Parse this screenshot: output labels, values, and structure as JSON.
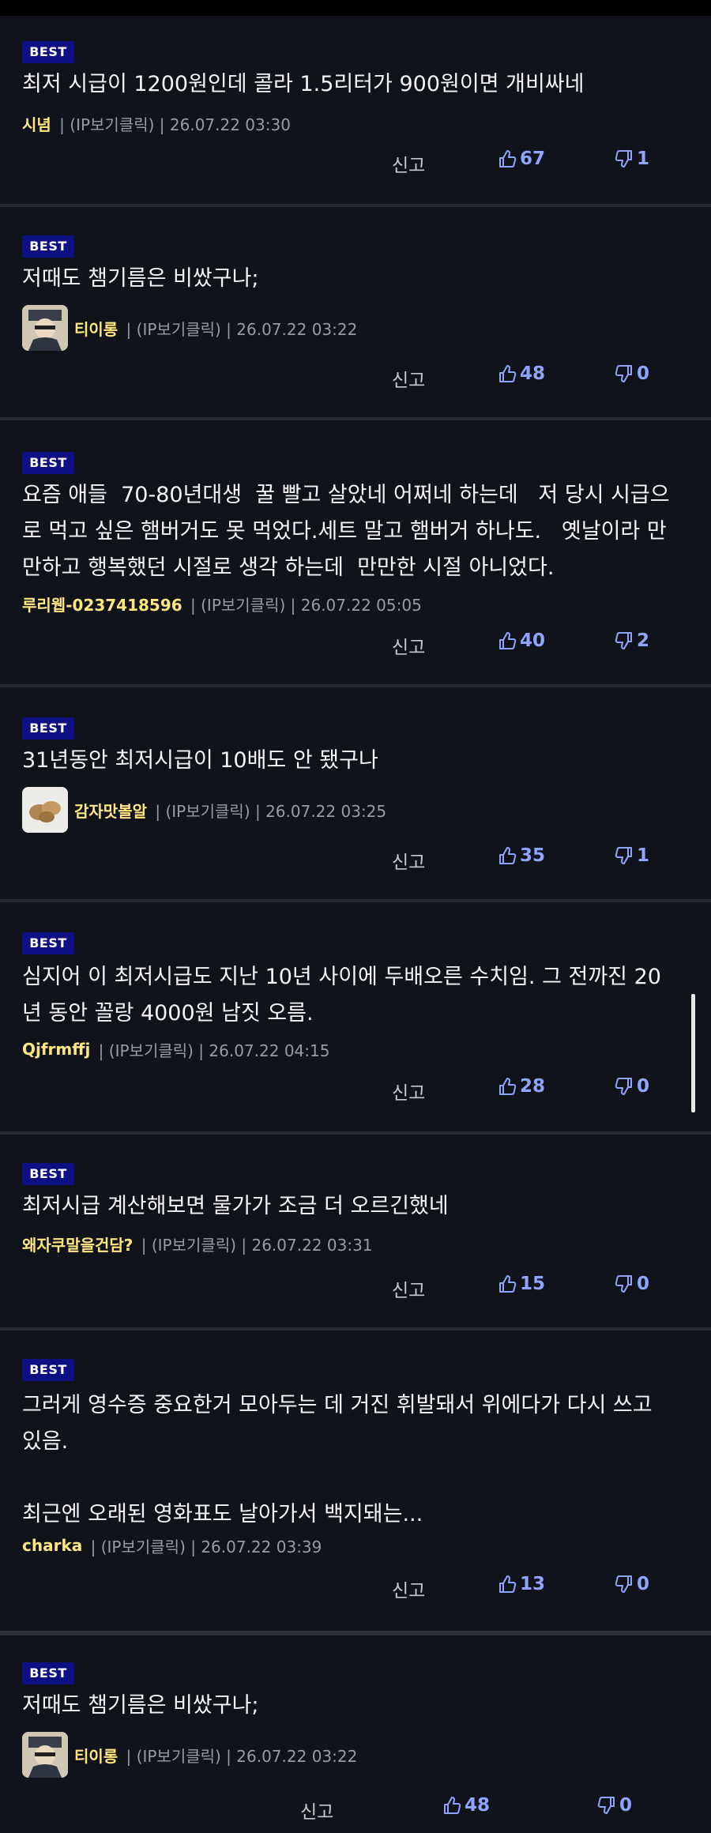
{
  "labels": {
    "report": "신고"
  },
  "comments": [
    {
      "badge": "BEST",
      "text": "최저 시급이 1200원인데 콜라 1.5리터가 900원이면 개비싸네",
      "nick": "시념",
      "meta": " | (IP보기클릭) | 26.07.22 03:30",
      "likes": "67",
      "dislikes": "1"
    },
    {
      "badge": "BEST",
      "text": "저때도 챔기름은 비쌌구나;",
      "nick": "티이롱",
      "meta": " | (IP보기클릭) | 26.07.22 03:22",
      "likes": "48",
      "dislikes": "0"
    },
    {
      "badge": "BEST",
      "text": "요즘 애들  70-80년대생  꿀 빨고 살았네 어쩌네 하는데   저 당시 시급으\n로 먹고 싶은 햄버거도 못 먹었다.세트 말고 햄버거 하나도.   옛날이라 만\n만하고 행복했던 시절로 생각 하는데  만만한 시절 아니었다.",
      "nick": "루리웹-0237418596",
      "meta": " | (IP보기클릭) | 26.07.22 05:05",
      "likes": "40",
      "dislikes": "2"
    },
    {
      "badge": "BEST",
      "text": "31년동안 최저시급이 10배도 안 됐구나",
      "nick": "감자맛볼알",
      "meta": " | (IP보기클릭) | 26.07.22 03:25",
      "likes": "35",
      "dislikes": "1"
    },
    {
      "badge": "BEST",
      "text": "심지어 이 최저시급도 지난 10년 사이에 두배오른 수치임. 그 전까진 20\n년 동안 꼴랑 4000원 남짓 오름.",
      "nick": "Qjfrmffj",
      "meta": " | (IP보기클릭) | 26.07.22 04:15",
      "likes": "28",
      "dislikes": "0"
    },
    {
      "badge": "BEST",
      "text": "최저시급 계산해보면 물가가 조금 더 오르긴했네",
      "nick": "왜자쿠말을건담?",
      "meta": " | (IP보기클릭) | 26.07.22 03:31",
      "likes": "15",
      "dislikes": "0"
    },
    {
      "badge": "BEST",
      "text": "그러게 영수증 중요한거 모아두는 데 거진 휘발돼서 위에다가 다시 쓰고\n있음.\n\n최근엔 오래된 영화표도 날아가서 백지돼는...",
      "nick": "charka",
      "meta": " | (IP보기클릭) | 26.07.22 03:39",
      "likes": "13",
      "dislikes": "0"
    },
    {
      "badge": "BEST",
      "text": "저때도 챔기름은 비쌌구나;",
      "nick": "티이롱",
      "meta": " | (IP보기클릭) | 26.07.22 03:22",
      "likes": "48",
      "dislikes": "0"
    }
  ],
  "colors": {
    "background": "#11131a",
    "badge": "#0d0f82",
    "nickname": "#ffe680",
    "vote": "#8fa4ff"
  },
  "icons": {
    "like": "thumbs-up-icon",
    "dislike": "thumbs-down-icon",
    "avatar_1": "manga-character-avatar",
    "avatar_2": "potatoes-avatar"
  }
}
